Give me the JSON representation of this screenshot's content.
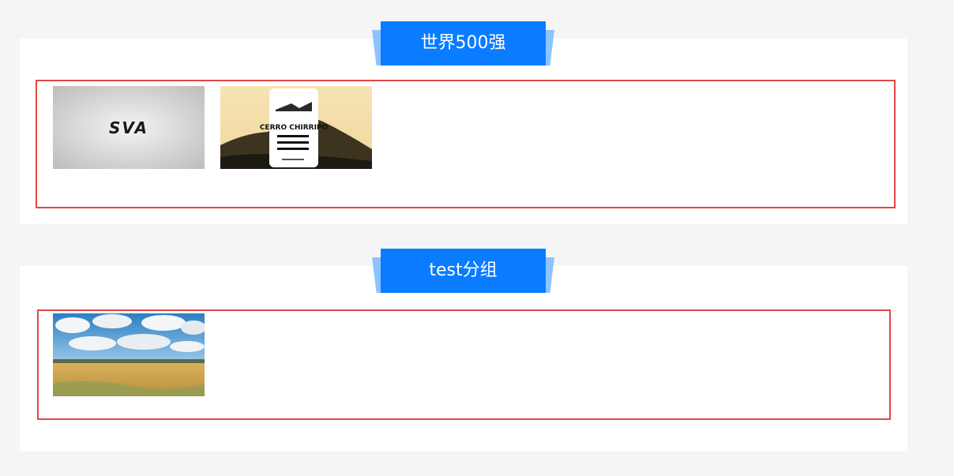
{
  "groups": [
    {
      "title": "世界500强",
      "logos": [
        {
          "icon": "sva-logo-icon",
          "text": "SVA"
        },
        {
          "icon": "cerro-chirripo-logo-icon",
          "text": "CERRO CHIRRIPO"
        }
      ]
    },
    {
      "title": "test分组",
      "logos": [
        {
          "icon": "wheat-field-sky-image-icon"
        }
      ]
    }
  ],
  "colors": {
    "tab_blue": "#0a7cff",
    "tab_wing": "#8cc4ff",
    "border_red": "#e04848",
    "page_bg": "#f5f5f5"
  }
}
